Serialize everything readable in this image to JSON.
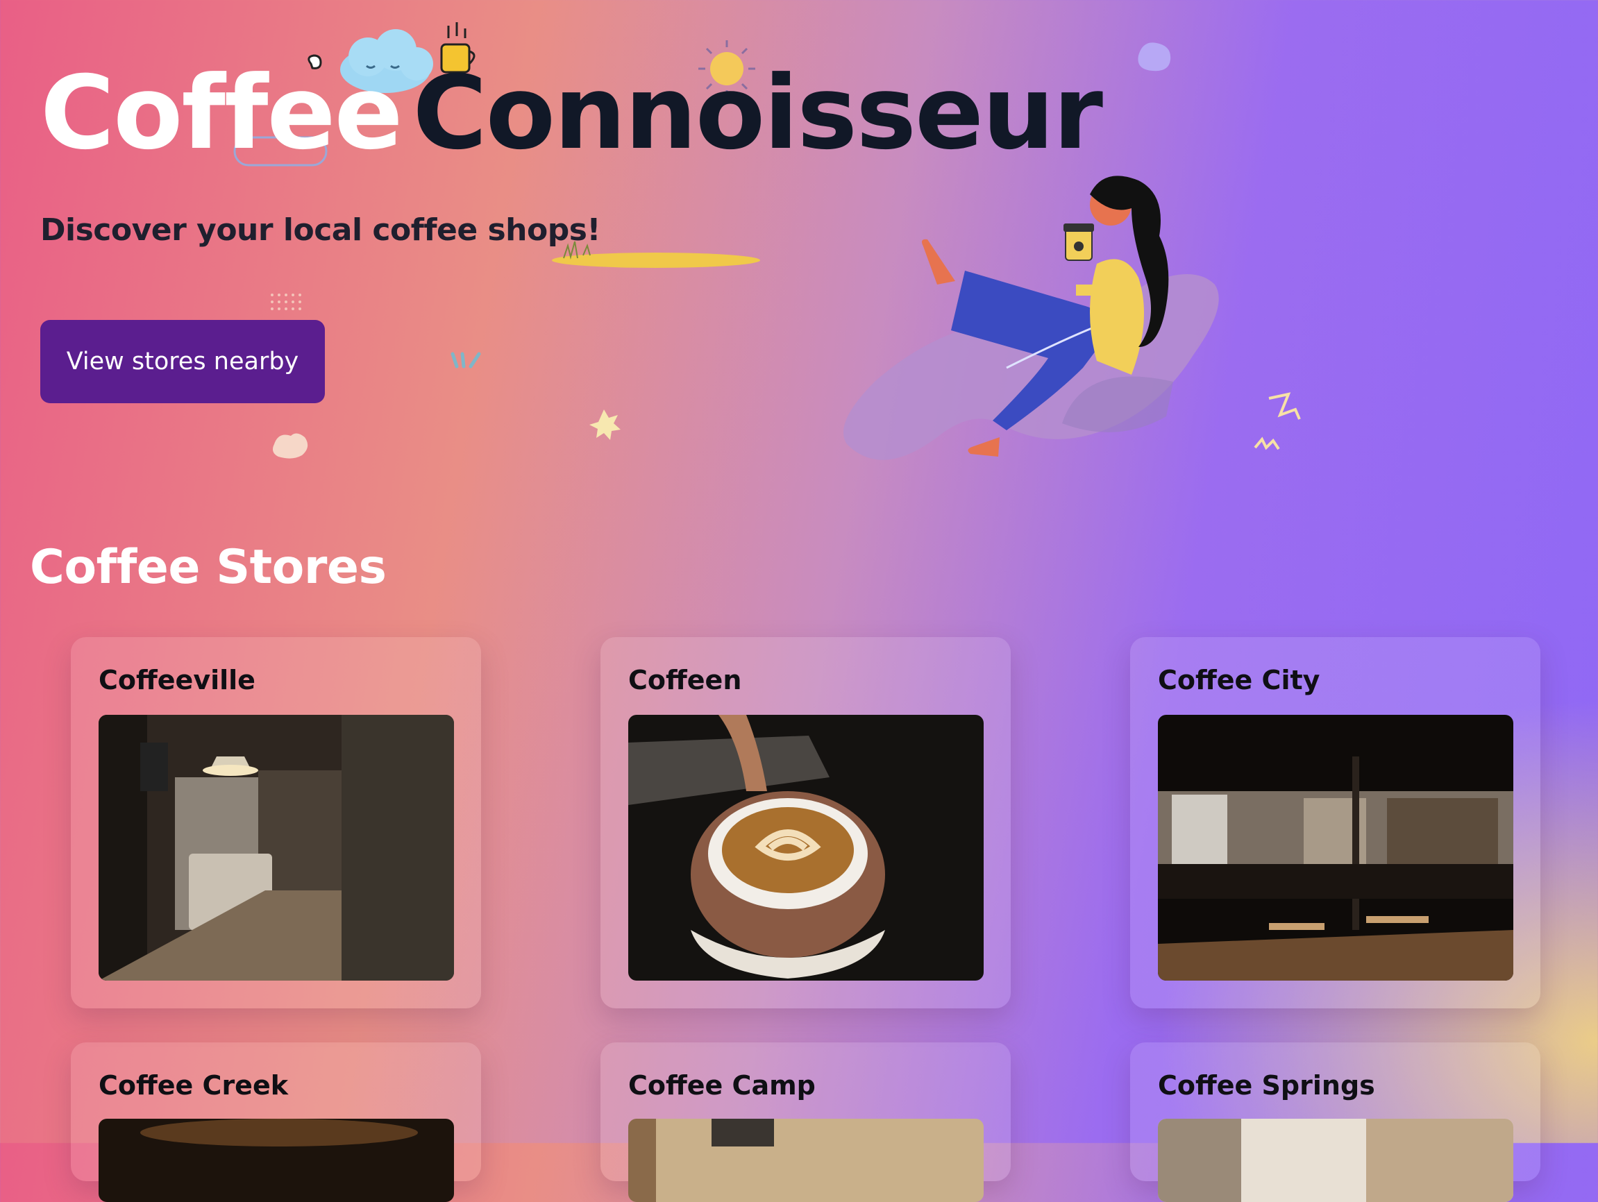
{
  "hero": {
    "title_part1": "Coffee",
    "title_part2": "Connoisseur",
    "subtitle": "Discover your local coffee shops!",
    "cta_label": "View stores nearby"
  },
  "stores_section": {
    "heading": "Coffee Stores",
    "stores": [
      {
        "name": "Coffeeville",
        "image": "cafe-counter-photo"
      },
      {
        "name": "Coffeen",
        "image": "latte-art-photo"
      },
      {
        "name": "Coffee City",
        "image": "dark-cafe-interior-photo"
      },
      {
        "name": "Coffee Creek",
        "image": "coffee-cup-photo"
      },
      {
        "name": "Coffee Camp",
        "image": "cafe-chalkboard-photo"
      },
      {
        "name": "Coffee Springs",
        "image": "cafe-window-photo"
      }
    ]
  },
  "colors": {
    "button": "#5b1e8f",
    "title_dark": "#111827",
    "gradient_left": "#e95f86",
    "gradient_right": "#8f68f5",
    "gradient_corner": "#f0d282"
  }
}
